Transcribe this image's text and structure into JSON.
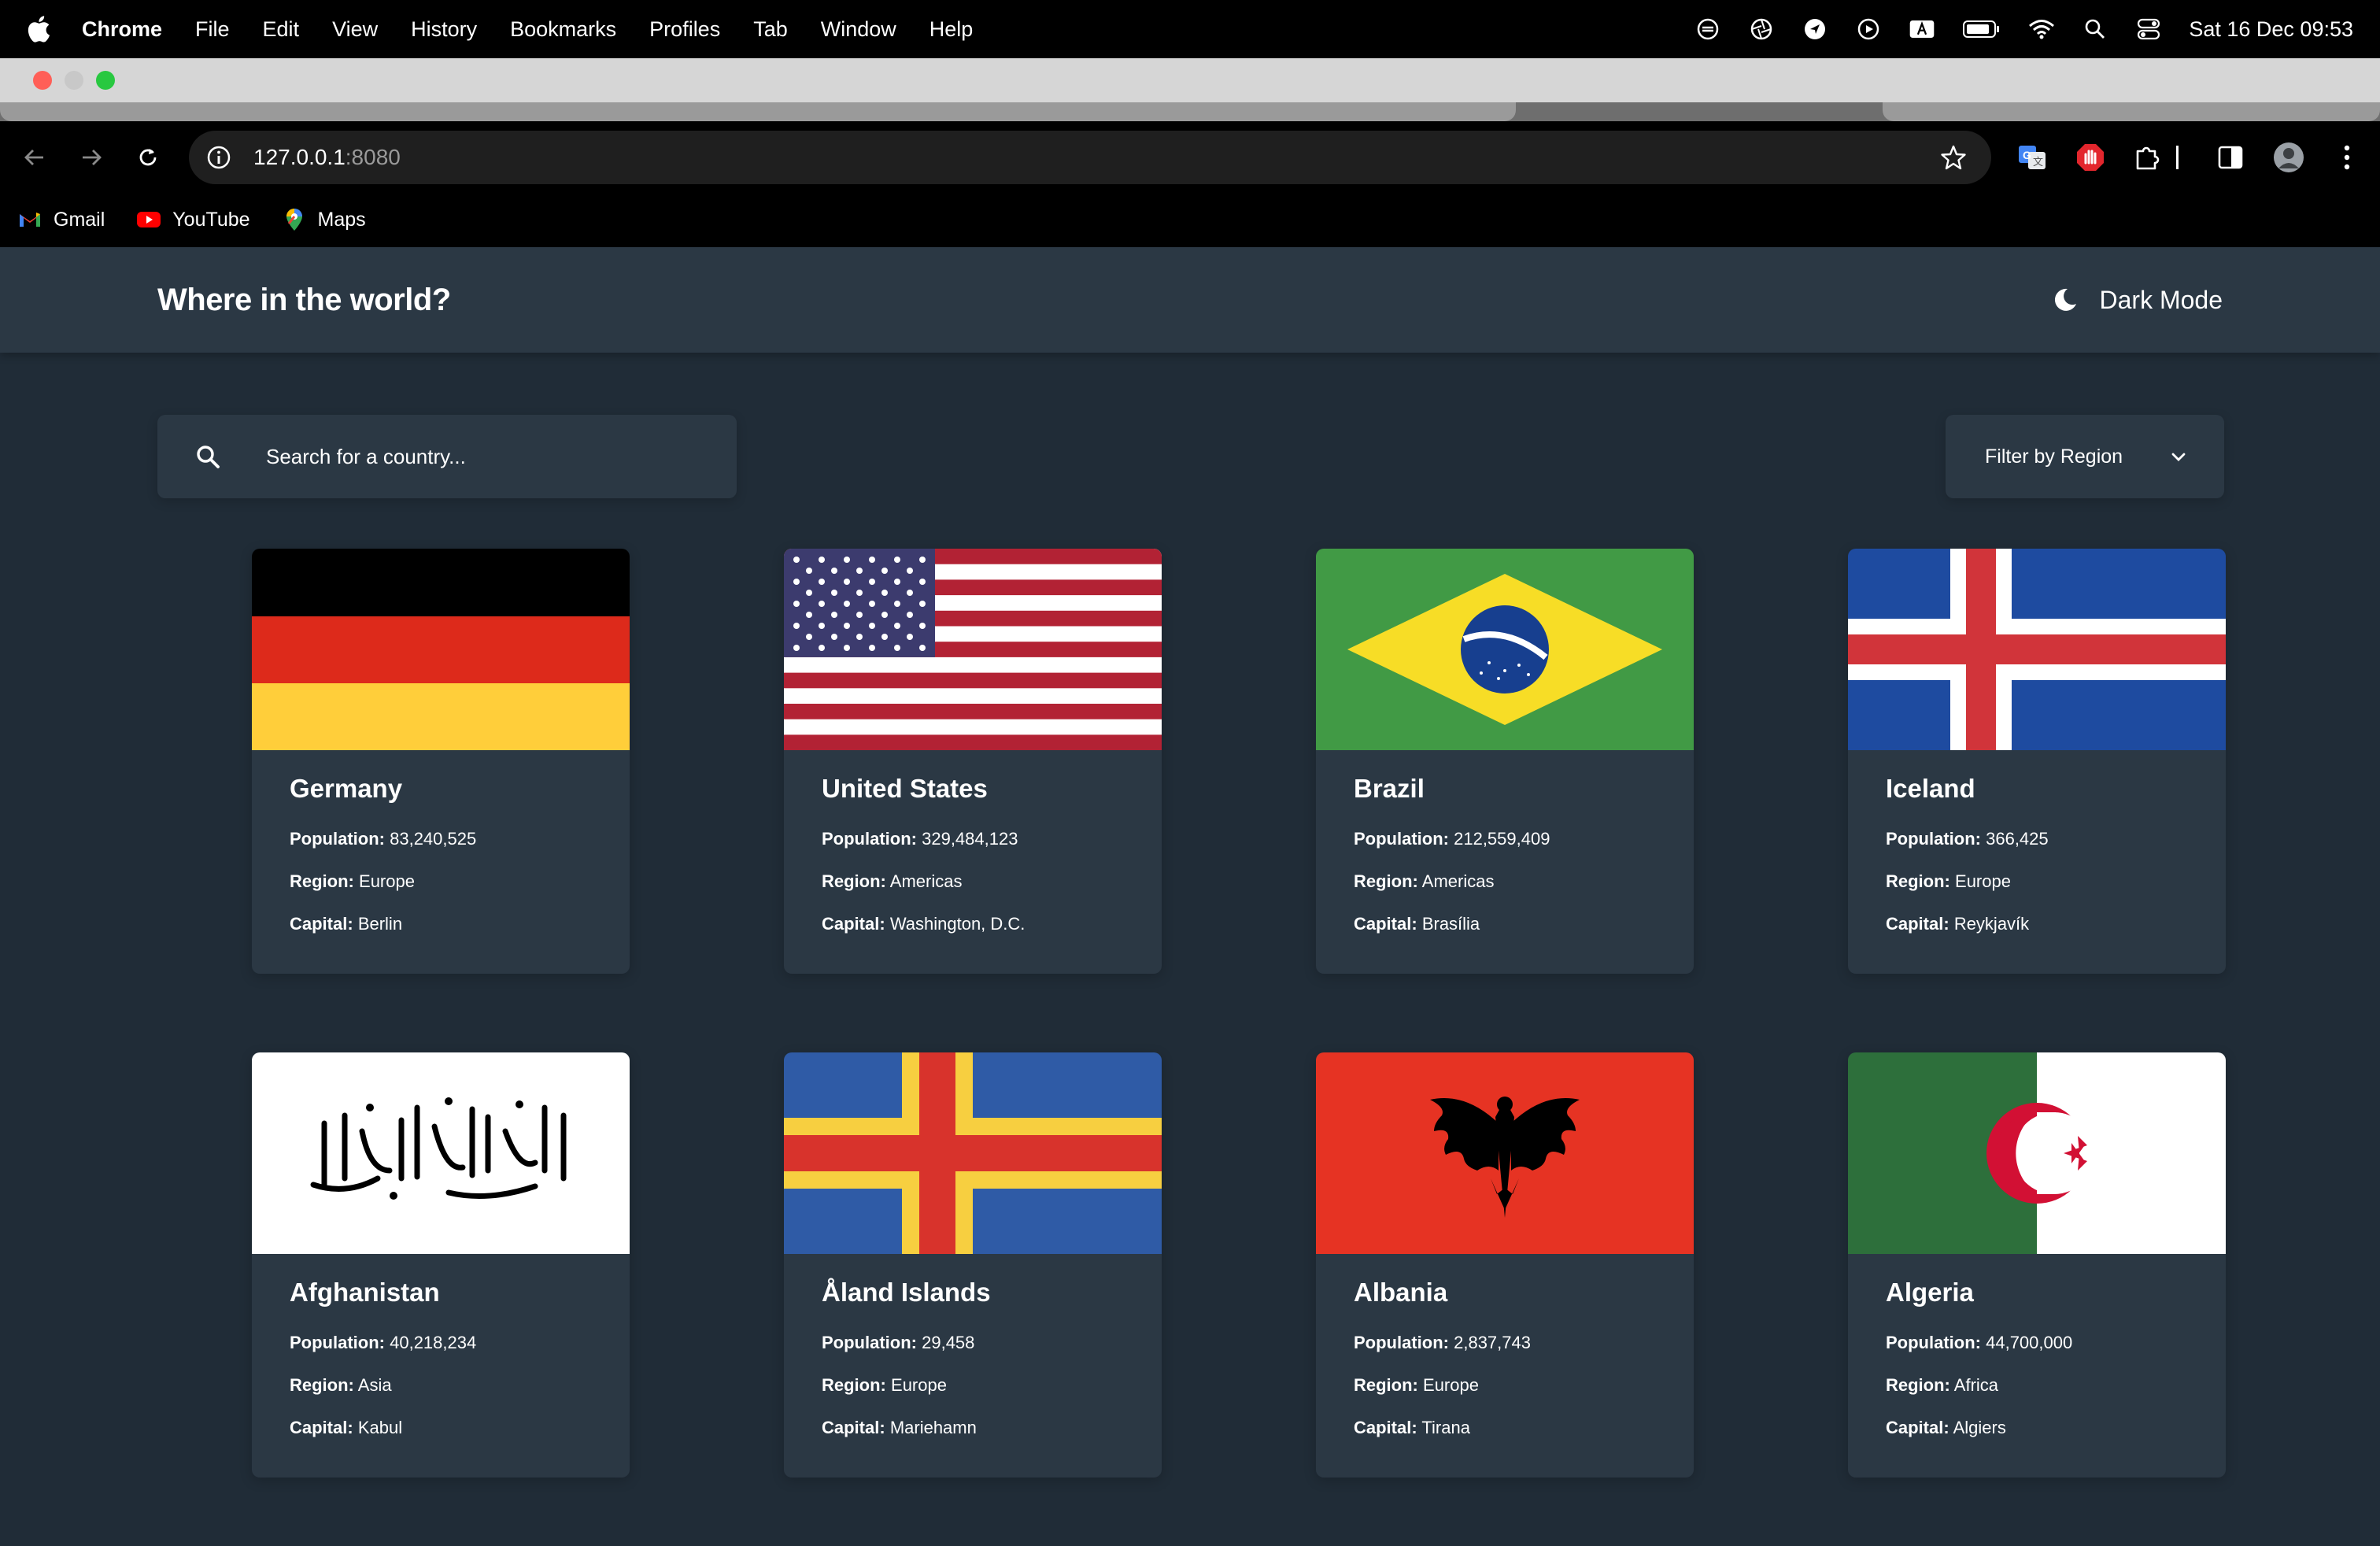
{
  "menubar": {
    "app_name": "Chrome",
    "items": [
      "File",
      "Edit",
      "View",
      "History",
      "Bookmarks",
      "Profiles",
      "Tab",
      "Window",
      "Help"
    ],
    "clock": "Sat 16 Dec  09:53"
  },
  "browser": {
    "url_host": "127.0.0.1",
    "url_port": ":8080",
    "bookmarks": [
      {
        "label": "Gmail",
        "icon": "gmail-icon"
      },
      {
        "label": "YouTube",
        "icon": "youtube-icon"
      },
      {
        "label": "Maps",
        "icon": "maps-icon"
      }
    ]
  },
  "site": {
    "title": "Where in the world?",
    "theme_toggle": "Dark Mode",
    "search_placeholder": "Search for a country...",
    "filter_label": "Filter by Region"
  },
  "labels": {
    "population": "Population:",
    "region": "Region:",
    "capital": "Capital:"
  },
  "countries": [
    {
      "name": "Germany",
      "population": "83,240,525",
      "region": "Europe",
      "capital": "Berlin",
      "flag": "germany-flag"
    },
    {
      "name": "United States",
      "population": "329,484,123",
      "region": "Americas",
      "capital": "Washington, D.C.",
      "flag": "united-states-flag"
    },
    {
      "name": "Brazil",
      "population": "212,559,409",
      "region": "Americas",
      "capital": "Brasília",
      "flag": "brazil-flag"
    },
    {
      "name": "Iceland",
      "population": "366,425",
      "region": "Europe",
      "capital": "Reykjavík",
      "flag": "iceland-flag"
    },
    {
      "name": "Afghanistan",
      "population": "40,218,234",
      "region": "Asia",
      "capital": "Kabul",
      "flag": "afghanistan-flag"
    },
    {
      "name": "Åland Islands",
      "population": "29,458",
      "region": "Europe",
      "capital": "Mariehamn",
      "flag": "aland-islands-flag"
    },
    {
      "name": "Albania",
      "population": "2,837,743",
      "region": "Europe",
      "capital": "Tirana",
      "flag": "albania-flag"
    },
    {
      "name": "Algeria",
      "population": "44,700,000",
      "region": "Africa",
      "capital": "Algiers",
      "flag": "algeria-flag"
    }
  ],
  "colors": {
    "page_bg": "#202c37",
    "element_bg": "#2b3844",
    "text": "#ffffff"
  }
}
